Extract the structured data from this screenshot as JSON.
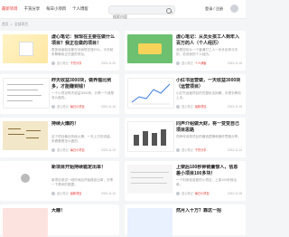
{
  "nav": [
    "最新项目",
    "干货分享",
    "每日小项目",
    "个人博客"
  ],
  "search": {
    "placeholder": "搜索内容"
  },
  "auth": {
    "login": "登录",
    "separator": "/",
    "register": "注册"
  },
  "breadcrumb": {
    "home": "首页",
    "sep": ">",
    "section": "全部项目"
  },
  "cards": [
    {
      "title": "虚心笔记：我现在主要在做什么项目？我正在做的项目！",
      "excerpt": "很多读者朋友都在问我现在做什么，今天就来聊聊我正在做的项目。",
      "author": "虚心笔记",
      "tag": "干货分享",
      "time": "2023-11-20",
      "views": "3521"
    },
    {
      "title": "虚心笔记：从员女孩工人到年入百万的人（个人经历）",
      "excerpt": "我是如何从一个普通打工人一步步走到今天的，说说我的个人经历。",
      "author": "虚心笔记",
      "tag": "个人博客",
      "time": "2023-11-18",
      "views": "2908"
    },
    {
      "title": "昨天收益3000块，做养猫比例多，才能赚到钱！",
      "excerpt": "一个小项目昨天收益3000块，分享一下我是怎么做的。",
      "author": "虚心笔记",
      "tag": "每日小项目",
      "time": "2023-11-16",
      "views": "4102"
    },
    {
      "title": "小红书运营做，一天收益3000块（运营项目）",
      "excerpt": "小红书运营项目的完整玩法拆解，手把手教你上手。",
      "author": "虚心笔记",
      "tag": "最新项目",
      "time": "2023-11-15",
      "views": "3377"
    },
    {
      "title": "持续火爆的！",
      "excerpt": "这个项目最近持续火爆，一天上万的流量，来看看是怎么做的。",
      "author": "虚心笔记",
      "tag": "每日小项目",
      "time": "2023-11-13",
      "views": "1986"
    },
    {
      "title": "同声介绍做大财，将一变变自己项目思路",
      "excerpt": "同声传译类项目的赚钱逻辑和操作思路分享。",
      "author": "虚心笔记",
      "tag": "干货分享",
      "time": "2023-11-12",
      "views": "2214"
    },
    {
      "title": "新项目开始持续稳定出单！",
      "excerpt": "新项目测试一段时间后开始稳定出单，分享一下具体的数据。",
      "author": "虚心笔记",
      "tag": "最新项目",
      "time": "2023-11-10",
      "views": "2750"
    },
    {
      "title": "上架后100秒钟销量惊人，信息差小项目100多块！",
      "excerpt": "一个利用信息差的小项目，上架100秒就出单。",
      "author": "虚心笔记",
      "tag": "每日小项目",
      "time": "2023-11-08",
      "views": "3190"
    },
    {
      "title": "大赚！",
      "excerpt": "",
      "author": "",
      "tag": "",
      "time": "",
      "views": ""
    },
    {
      "title": "然月入十万？靠这一招",
      "excerpt": "",
      "author": "",
      "tag": "",
      "time": "",
      "views": ""
    }
  ]
}
